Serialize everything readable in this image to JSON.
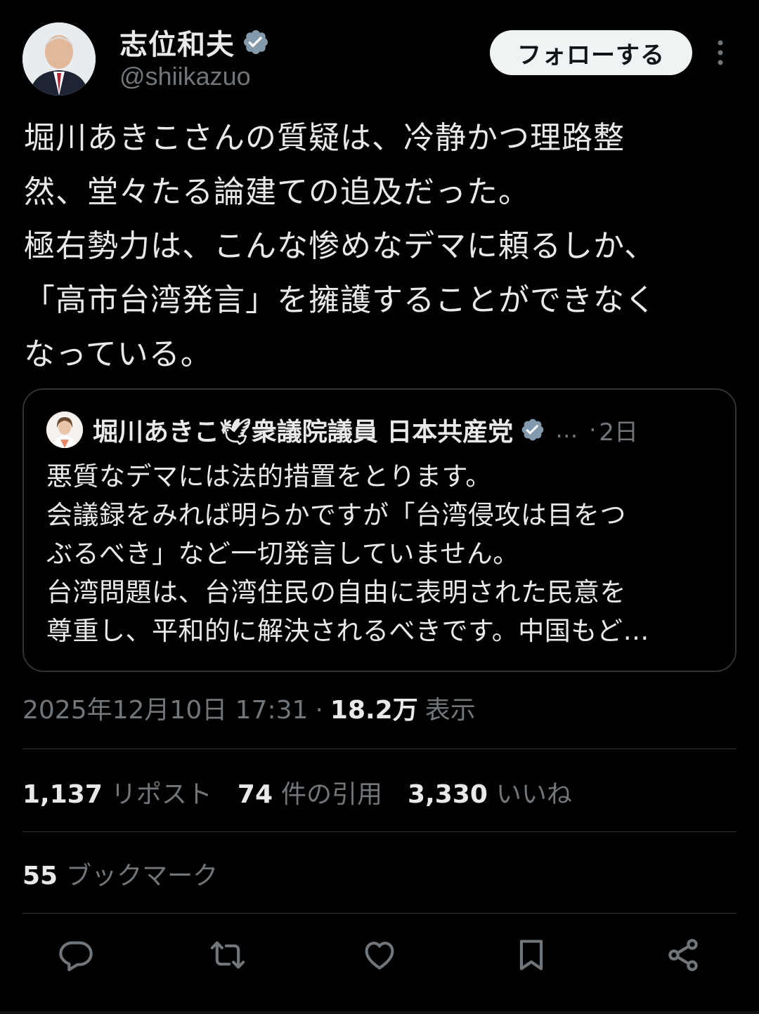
{
  "author": {
    "display_name": "志位和夫",
    "handle": "@shiikazuo"
  },
  "follow_label": "フォローする",
  "tweet_text": "堀川あきこさんの質疑は、冷静かつ理路整\n然、堂々たる論建ての追及だった。\n極右勢力は、こんな惨めなデマに頼るしか、\n「高市台湾発言」を擁護することができなく\nなっている。",
  "quote": {
    "name": "堀川あきこ🕊衆議院議員 日本共産党",
    "ellipsis": "…",
    "separator": "·",
    "time": "2日",
    "text": "悪質なデマには法的措置をとります。\n会議録をみれば明らかですが「台湾侵攻は目をつ\nぶるべき」など一切発言していません。\n台湾問題は、台湾住民の自由に表明された民意を\n尊重し、平和的に解決されるべきです。中国もど…"
  },
  "meta": {
    "timestamp": "2025年12月10日 17:31",
    "separator": "·",
    "views": "18.2万",
    "views_label": "表示"
  },
  "stats": {
    "reposts": "1,137",
    "reposts_label": "リポスト",
    "quotes": "74",
    "quotes_label": "件の引用",
    "likes": "3,330",
    "likes_label": "いいね"
  },
  "bookmarks": {
    "count": "55",
    "label": "ブックマーク"
  },
  "actions": [
    "reply-icon",
    "repost-icon",
    "like-icon",
    "bookmark-icon",
    "share-icon"
  ],
  "colors": {
    "background": "#000000",
    "text": "#e7e9ea",
    "secondary": "#71767b",
    "border": "#2f3336",
    "verified": "#829aab",
    "button": "#eff3f4"
  }
}
